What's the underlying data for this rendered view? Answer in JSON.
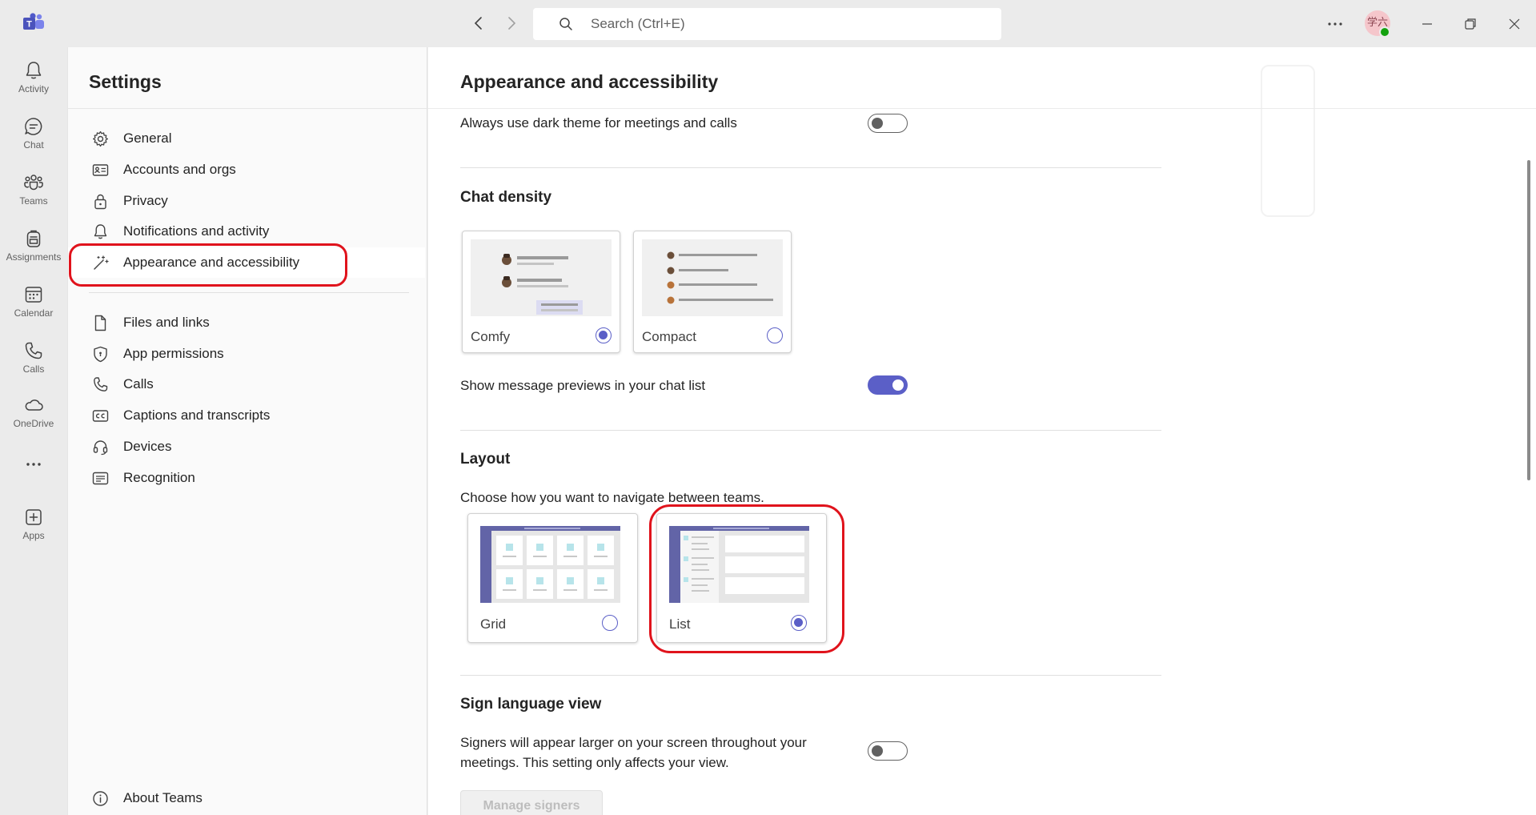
{
  "titlebar": {
    "search_placeholder": "Search (Ctrl+E)",
    "avatar_initials": "学六"
  },
  "rail": [
    {
      "label": "Activity",
      "icon": "bell-icon"
    },
    {
      "label": "Chat",
      "icon": "chat-icon"
    },
    {
      "label": "Teams",
      "icon": "teams-icon"
    },
    {
      "label": "Assignments",
      "icon": "backpack-icon"
    },
    {
      "label": "Calendar",
      "icon": "calendar-icon"
    },
    {
      "label": "Calls",
      "icon": "phone-icon"
    },
    {
      "label": "OneDrive",
      "icon": "cloud-icon"
    },
    {
      "label": "",
      "icon": "more-icon"
    },
    {
      "label": "Apps",
      "icon": "add-app-icon"
    }
  ],
  "settings": {
    "title": "Settings",
    "items": [
      {
        "label": "General",
        "icon": "gear-icon"
      },
      {
        "label": "Accounts and orgs",
        "icon": "id-card-icon"
      },
      {
        "label": "Privacy",
        "icon": "lock-icon"
      },
      {
        "label": "Notifications and activity",
        "icon": "bell-icon"
      },
      {
        "label": "Appearance and accessibility",
        "icon": "magic-wand-icon",
        "active": true
      },
      {
        "label": "Files and links",
        "icon": "file-icon"
      },
      {
        "label": "App permissions",
        "icon": "shield-icon"
      },
      {
        "label": "Calls",
        "icon": "phone-icon"
      },
      {
        "label": "Captions and transcripts",
        "icon": "cc-icon"
      },
      {
        "label": "Devices",
        "icon": "headset-icon"
      },
      {
        "label": "Recognition",
        "icon": "recognition-icon"
      }
    ],
    "about": "About Teams"
  },
  "content": {
    "title": "Appearance and accessibility",
    "dark_theme_label": "Always use dark theme for meetings and calls",
    "dark_theme_on": false,
    "chat_density": {
      "heading": "Chat density",
      "options": [
        {
          "label": "Comfy",
          "selected": true
        },
        {
          "label": "Compact",
          "selected": false
        }
      ]
    },
    "message_previews_label": "Show message previews in your chat list",
    "message_previews_on": true,
    "layout": {
      "heading": "Layout",
      "description": "Choose how you want to navigate between teams.",
      "options": [
        {
          "label": "Grid",
          "selected": false
        },
        {
          "label": "List",
          "selected": true
        }
      ]
    },
    "sign_language": {
      "heading": "Sign language view",
      "description_line1": "Signers will appear larger on your screen throughout your",
      "description_line2": "meetings. This setting only affects your view.",
      "enabled": false,
      "manage_button": "Manage signers"
    }
  },
  "colors": {
    "accent": "#5b5fc7",
    "highlight": "#e0131c",
    "titlebar_bg": "#ebebeb"
  }
}
